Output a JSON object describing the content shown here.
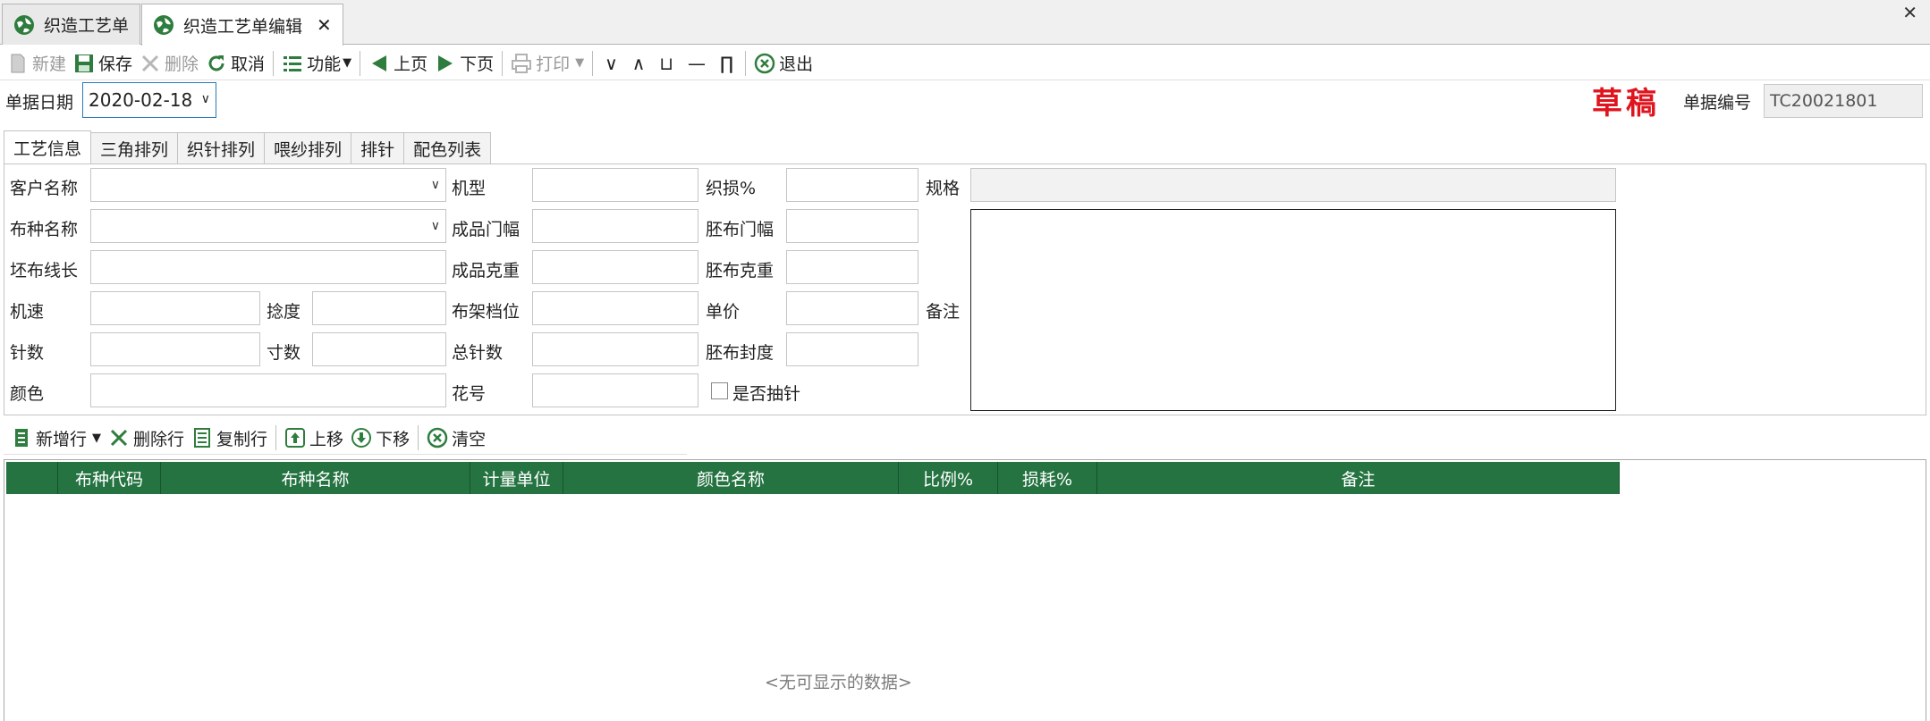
{
  "window": {
    "tabs": [
      {
        "label": "织造工艺单"
      },
      {
        "label": "织造工艺单编辑"
      }
    ],
    "tab_close": "✕",
    "window_close": "✕"
  },
  "toolbar": {
    "new": "新建",
    "save": "保存",
    "delete": "删除",
    "cancel": "取消",
    "function": "功能",
    "prev": "上页",
    "next": "下页",
    "print": "打印",
    "sym_down": "∨",
    "sym_up": "∧",
    "sym_cup": "⊔",
    "sym_dash": "—",
    "sym_cap": "∏",
    "exit": "退出"
  },
  "header": {
    "date_label": "单据日期",
    "date_value": "2020-02-18",
    "draft_stamp": "草稿",
    "docno_label": "单据编号",
    "docno_value": "TC20021801"
  },
  "inner_tabs": [
    "工艺信息",
    "三角排列",
    "织针排列",
    "喂纱排列",
    "排针",
    "配色列表"
  ],
  "form": {
    "customer_name": "客户名称",
    "fabric_name": "布种名称",
    "grey_yarn_length": "坯布线长",
    "machine_speed": "机速",
    "twist": "捻度",
    "needle_count": "针数",
    "gauge": "寸数",
    "color": "颜色",
    "machine_model": "机型",
    "finished_width": "成品门幅",
    "finished_weight": "成品克重",
    "rack_position": "布架档位",
    "total_needles": "总针数",
    "pattern_no": "花号",
    "knit_loss": "织损%",
    "grey_width": "胚布门幅",
    "grey_weight": "胚布克重",
    "unit_price": "单价",
    "grey_density": "胚布封度",
    "needle_pull": "是否抽针",
    "spec": "规格",
    "remark": "备注"
  },
  "grid_toolbar": {
    "add_row": "新增行",
    "delete_row": "删除行",
    "copy_row": "复制行",
    "move_up": "上移",
    "move_down": "下移",
    "clear": "清空"
  },
  "grid": {
    "columns": [
      "布种代码",
      "布种名称",
      "计量单位",
      "颜色名称",
      "比例%",
      "损耗%",
      "备注"
    ],
    "empty_text": "<无可显示的数据>"
  },
  "colors": {
    "accent_green": "#247341",
    "draft_red": "#e0141e",
    "focus_blue": "#2a7ab8"
  }
}
